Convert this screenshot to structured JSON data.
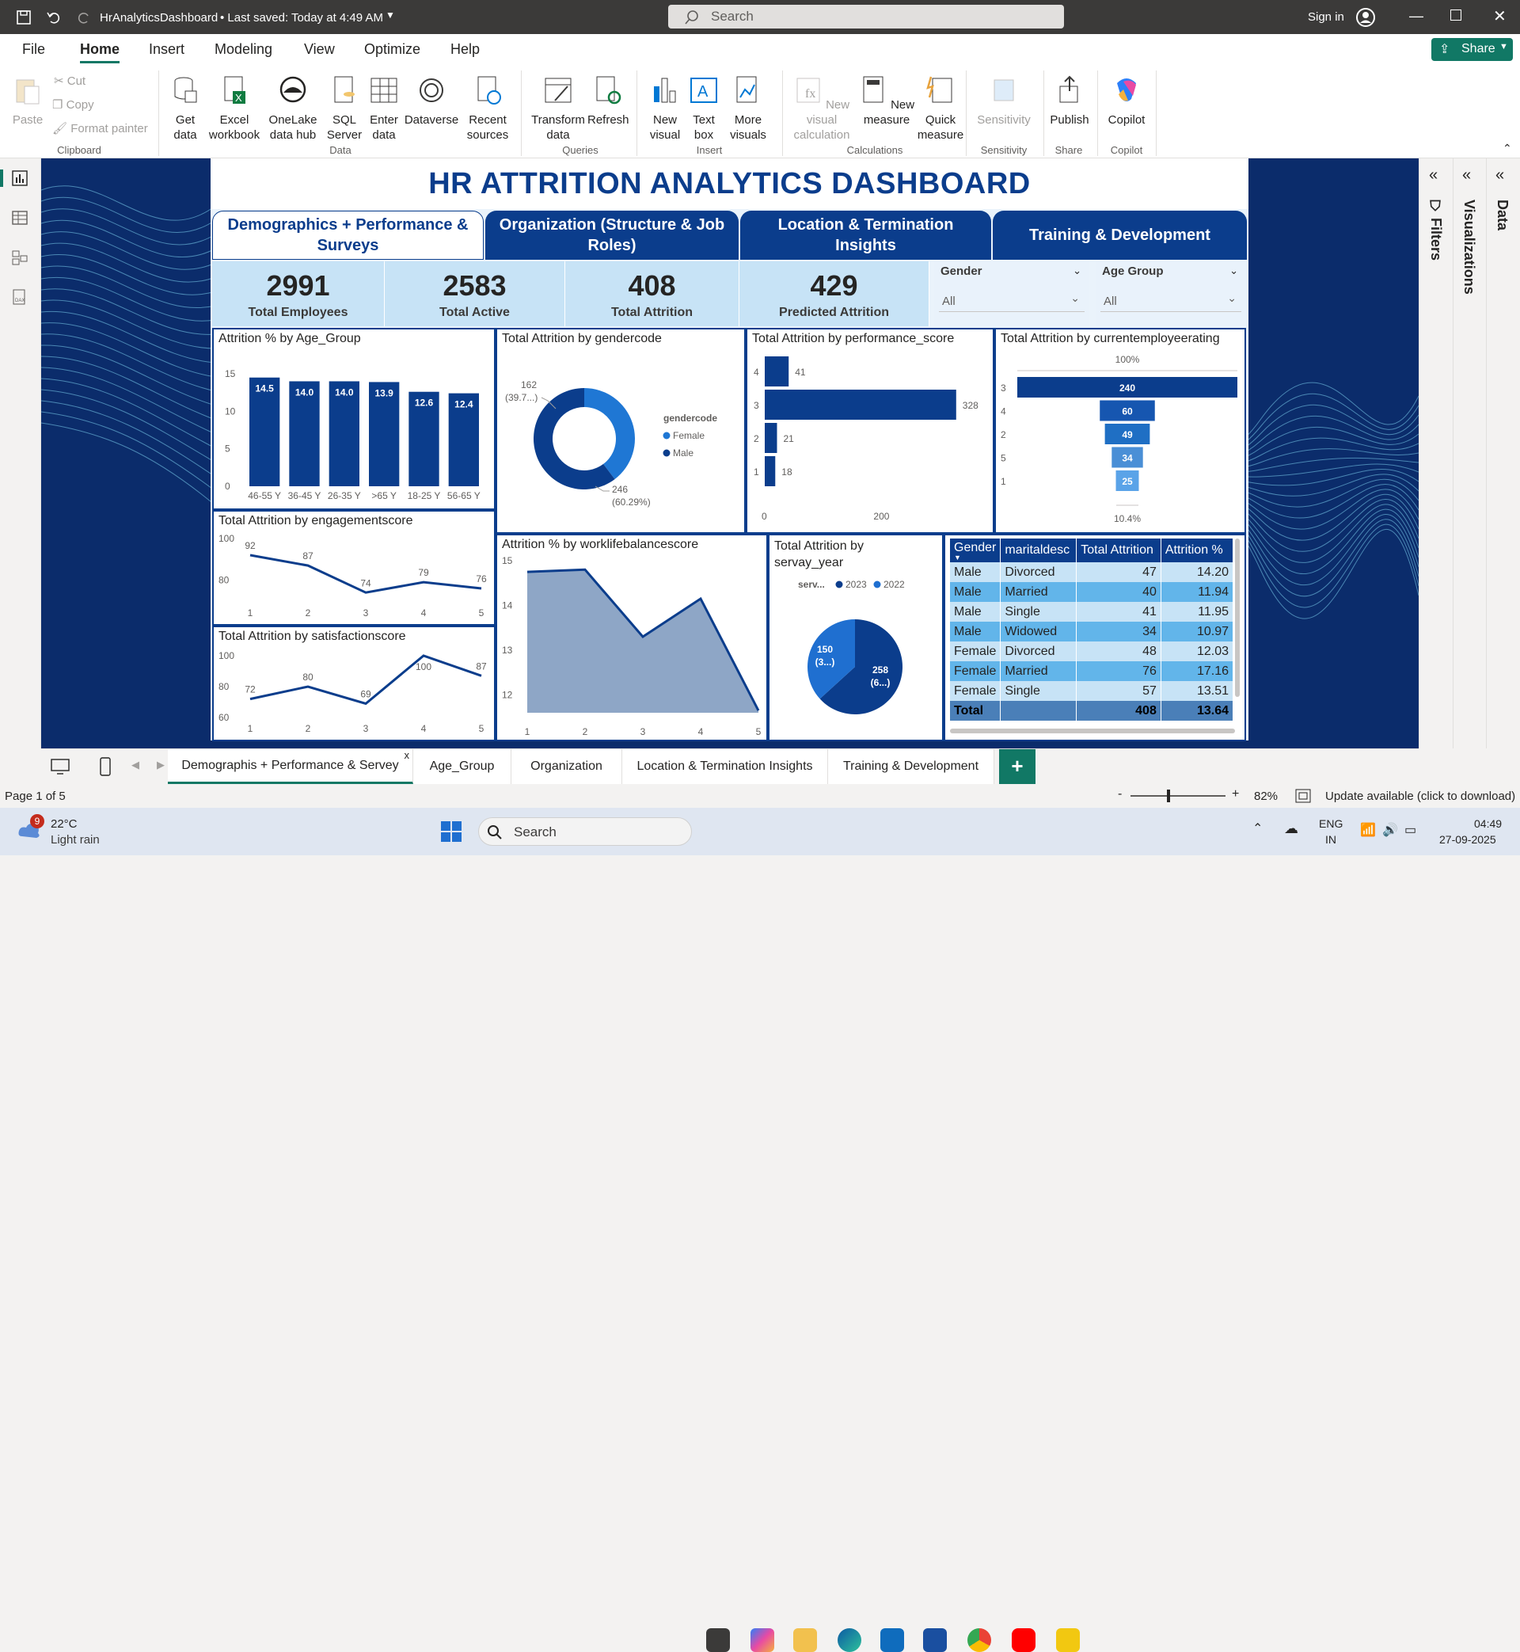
{
  "titlebar": {
    "file_name": "HrAnalyticsDashboard",
    "saved": "• Last saved: Today at 4:49 AM",
    "search_placeholder": "Search",
    "sign_in": "Sign in"
  },
  "menu": {
    "items": [
      "File",
      "Home",
      "Insert",
      "Modeling",
      "View",
      "Optimize",
      "Help"
    ],
    "active": "Home",
    "share": "Share"
  },
  "ribbon": {
    "clipboard": {
      "paste": "Paste",
      "cut": "Cut",
      "copy": "Copy",
      "format_painter": "Format painter",
      "group": "Clipboard"
    },
    "data": {
      "items": [
        "Get data",
        "Excel workbook",
        "OneLake data hub",
        "SQL Server",
        "Enter data",
        "Dataverse",
        "Recent sources"
      ],
      "group": "Data"
    },
    "queries": {
      "items": [
        "Transform data",
        "Refresh"
      ],
      "group": "Queries"
    },
    "insert": {
      "items": [
        "New visual",
        "Text box",
        "More visuals"
      ],
      "group": "Insert"
    },
    "calculations": {
      "items": [
        "New visual calculation",
        "New measure",
        "Quick measure"
      ],
      "group": "Calculations"
    },
    "sensitivity": {
      "label": "Sensitivity",
      "group": "Sensitivity"
    },
    "share": {
      "label": "Publish",
      "group": "Share"
    },
    "copilot": {
      "label": "Copilot",
      "group": "Copilot"
    }
  },
  "dashboard": {
    "title": "HR ATTRITION ANALYTICS DASHBOARD",
    "nav": [
      "Demographics + Performance & Surveys",
      "Organization (Structure & Job Roles)",
      "Location & Termination Insights",
      "Training & Development"
    ],
    "kpis": [
      {
        "value": "2991",
        "label": "Total Employees"
      },
      {
        "value": "2583",
        "label": "Total Active"
      },
      {
        "value": "408",
        "label": "Total Attrition"
      },
      {
        "value": "429",
        "label": "Predicted Attrition"
      }
    ],
    "slicers": [
      {
        "label": "Gender",
        "value": "All"
      },
      {
        "label": "Age Group",
        "value": "All"
      }
    ]
  },
  "chart_data": [
    {
      "id": "age",
      "type": "bar",
      "title": "Attrition % by Age_Group",
      "categories": [
        "46-55 Y",
        "36-45 Y",
        "26-35 Y",
        ">65 Y",
        "18-25 Y",
        "56-65 Y"
      ],
      "values": [
        14.5,
        14.0,
        14.0,
        13.9,
        12.6,
        12.4
      ],
      "labels": [
        "14.5",
        "14.0",
        "14.0",
        "13.9",
        "12.6",
        "12.4"
      ],
      "yticks": [
        0,
        5,
        10,
        15
      ],
      "ylim": [
        0,
        15
      ],
      "color": "#0b3d8c"
    },
    {
      "id": "gender",
      "type": "pie",
      "title": "Total Attrition by gendercode",
      "legend_title": "gendercode",
      "series": [
        {
          "name": "Female",
          "value": 162,
          "label": "162",
          "pct": "(39.7...)",
          "color": "#1f77d4"
        },
        {
          "name": "Male",
          "value": 246,
          "label": "246",
          "pct": "(60.29%)",
          "color": "#0b3d8c"
        }
      ]
    },
    {
      "id": "perf",
      "type": "bar",
      "title": "Total Attrition by performance_score",
      "categories": [
        "4",
        "3",
        "2",
        "1"
      ],
      "values": [
        41,
        328,
        21,
        18
      ],
      "xticks": [
        "0",
        "200"
      ],
      "xlim": [
        0,
        350
      ],
      "color": "#0b3d8c"
    },
    {
      "id": "rating",
      "type": "bar",
      "title": "Total Attrition by currentemployeerating",
      "categories": [
        "3",
        "4",
        "2",
        "5",
        "1"
      ],
      "values": [
        240,
        60,
        49,
        34,
        25
      ],
      "top_label": "100%",
      "bottom_label": "10.4%",
      "colors": [
        "#0b3d8c",
        "#1656b0",
        "#1f6fc4",
        "#4a8fd6",
        "#5aa3e8"
      ]
    },
    {
      "id": "engage",
      "type": "line",
      "title": "Total Attrition by engagementscore",
      "x": [
        "1",
        "2",
        "3",
        "4",
        "5"
      ],
      "values": [
        92,
        87,
        74,
        79,
        76
      ],
      "yticks": [
        "80",
        "100"
      ],
      "ylim": [
        68,
        100
      ],
      "color": "#0b3d8c"
    },
    {
      "id": "satisf",
      "type": "line",
      "title": "Total Attrition by satisfactionscore",
      "x": [
        "1",
        "2",
        "3",
        "4",
        "5"
      ],
      "values": [
        72,
        80,
        69,
        100,
        87
      ],
      "yticks": [
        "60",
        "80",
        "100"
      ],
      "ylim": [
        58,
        102
      ],
      "color": "#0b3d8c"
    },
    {
      "id": "wlb",
      "type": "area",
      "title": "Attrition % by worklifebalancescore",
      "x": [
        "1",
        "2",
        "3",
        "4",
        "5"
      ],
      "values": [
        14.75,
        14.8,
        13.3,
        14.15,
        11.65
      ],
      "yticks": [
        "12",
        "13",
        "14",
        "15"
      ],
      "ylim": [
        11.6,
        15
      ],
      "color": "#0b3d8c"
    },
    {
      "id": "survey",
      "type": "pie",
      "title": "Total Attrition by servay_year",
      "legend_title": "serv...",
      "series": [
        {
          "name": "2023",
          "value": 258,
          "label": "258",
          "pct": "(6...)",
          "color": "#0b3d8c"
        },
        {
          "name": "2022",
          "value": 150,
          "label": "150",
          "pct": "(3...)",
          "color": "#1f6fd0"
        }
      ]
    }
  ],
  "table": {
    "headers": [
      "Gender",
      "maritaldesc",
      "Total Attrition",
      "Attrition %"
    ],
    "rows": [
      [
        "Male",
        "Divorced",
        "47",
        "14.20"
      ],
      [
        "Male",
        "Married",
        "40",
        "11.94"
      ],
      [
        "Male",
        "Single",
        "41",
        "11.95"
      ],
      [
        "Male",
        "Widowed",
        "34",
        "10.97"
      ],
      [
        "Female",
        "Divorced",
        "48",
        "12.03"
      ],
      [
        "Female",
        "Married",
        "76",
        "17.16"
      ],
      [
        "Female",
        "Single",
        "57",
        "13.51"
      ]
    ],
    "total": [
      "Total",
      "",
      "408",
      "13.64"
    ]
  },
  "panes": {
    "filters": "Filters",
    "visualizations": "Visualizations",
    "data": "Data"
  },
  "tabs": [
    "Demographis + Performance & Servey",
    "Age_Group",
    "Organization",
    "Location & Termination Insights",
    "Training & Development"
  ],
  "status": {
    "page": "Page 1 of 5",
    "zoom": "82%",
    "update": "Update available (click to download)"
  },
  "taskbar": {
    "weather_temp": "22°C",
    "weather_desc": "Light rain",
    "badge": "9",
    "search": "Search",
    "lang1": "ENG",
    "lang2": "IN",
    "time": "04:49",
    "date": "27-09-2025"
  }
}
